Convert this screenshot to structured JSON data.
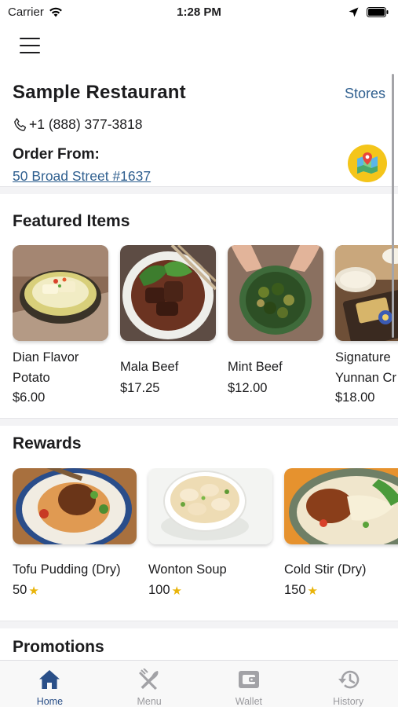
{
  "status_bar": {
    "carrier": "Carrier",
    "time": "1:28 PM"
  },
  "restaurant": {
    "name": "Sample Restaurant",
    "stores_link": "Stores",
    "phone": "+1 (888) 377-3818",
    "order_from_label": "Order From:",
    "address": "50 Broad Street #1637"
  },
  "featured": {
    "title": "Featured Items",
    "items": [
      {
        "name": "Dian Flavor Potato",
        "price": "$6.00"
      },
      {
        "name": "Mala Beef",
        "price": "$17.25"
      },
      {
        "name": "Mint Beef",
        "price": "$12.00"
      },
      {
        "name": "Signature Yunnan Cr",
        "price": "$18.00"
      }
    ]
  },
  "rewards": {
    "title": "Rewards",
    "items": [
      {
        "name": "Tofu Pudding (Dry)",
        "points": "50"
      },
      {
        "name": "Wonton Soup",
        "points": "100"
      },
      {
        "name": "Cold Stir (Dry)",
        "points": "150"
      }
    ]
  },
  "promotions": {
    "title": "Promotions"
  },
  "tabs": [
    {
      "label": "Home",
      "icon": "home-icon",
      "active": true
    },
    {
      "label": "Menu",
      "icon": "fork-knife-icon",
      "active": false
    },
    {
      "label": "Wallet",
      "icon": "wallet-icon",
      "active": false
    },
    {
      "label": "History",
      "icon": "history-icon",
      "active": false
    }
  ],
  "colors": {
    "link": "#2f5f8f",
    "active_tab": "#2a4f88",
    "inactive_tab": "#9a9a9e",
    "map_badge": "#f4c51a",
    "star": "#e9b40a"
  }
}
